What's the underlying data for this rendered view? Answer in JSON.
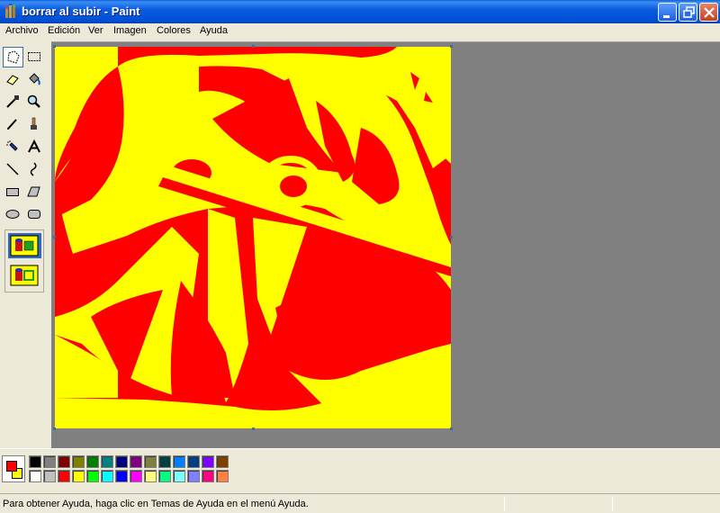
{
  "window": {
    "title": "borrar al subir - Paint"
  },
  "menu": {
    "items": [
      "Archivo",
      "Edición",
      "Ver",
      "Imagen",
      "Colores",
      "Ayuda"
    ]
  },
  "toolbox": {
    "tools": [
      "free-select-icon",
      "rect-select-icon",
      "eraser-icon",
      "fill-bucket-icon",
      "color-picker-icon",
      "magnifier-icon",
      "pencil-icon",
      "brush-icon",
      "airbrush-icon",
      "text-icon",
      "line-icon",
      "curve-icon",
      "rectangle-icon",
      "polygon-icon",
      "ellipse-icon",
      "rounded-rect-icon"
    ],
    "active_tool": "free-select-icon",
    "options": [
      "opaque-selection-icon",
      "transparent-selection-icon"
    ]
  },
  "colors": {
    "foreground": "#ff0000",
    "background": "#ffff00",
    "palette_top": [
      "#000000",
      "#808080",
      "#800000",
      "#808000",
      "#008000",
      "#008080",
      "#000080",
      "#800080",
      "#808040",
      "#004040",
      "#0080ff",
      "#004080",
      "#8000ff",
      "#804000"
    ],
    "palette_bottom": [
      "#ffffff",
      "#c0c0c0",
      "#ff0000",
      "#ffff00",
      "#00ff00",
      "#00ffff",
      "#0000ff",
      "#ff00ff",
      "#ffff80",
      "#00ff80",
      "#80ffff",
      "#8080ff",
      "#ff0080",
      "#ff8040"
    ]
  },
  "canvas": {
    "colors": [
      "#ff0000",
      "#ffff00"
    ]
  },
  "status": {
    "text": "Para obtener Ayuda, haga clic en Temas de Ayuda en el menú Ayuda."
  }
}
